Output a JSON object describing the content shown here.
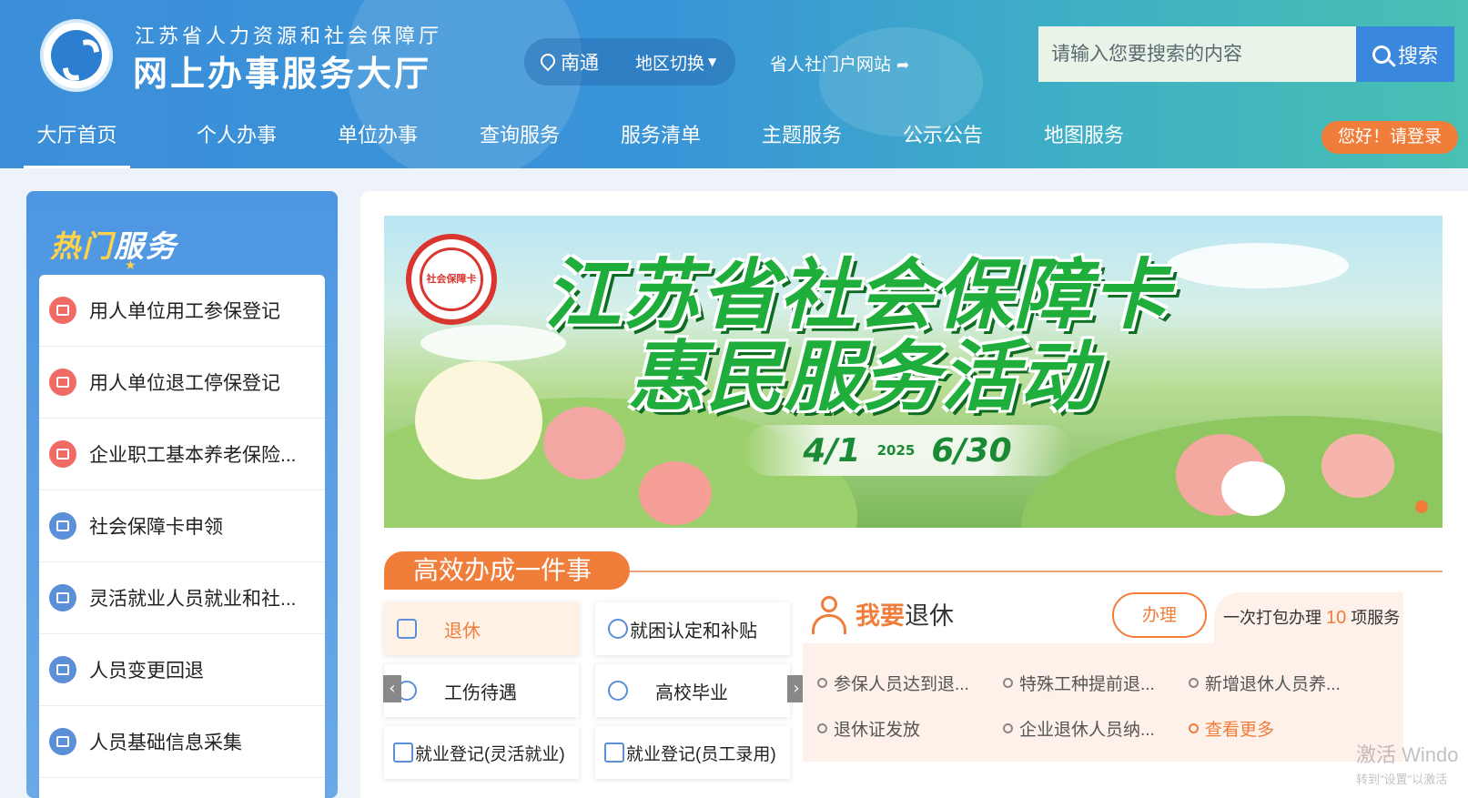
{
  "header": {
    "org_name": "江苏省人力资源和社会保障厅",
    "hall_name": "网上办事服务大厅",
    "region": {
      "city": "南通",
      "switch_label": "地区切换"
    },
    "portal_link": "省人社门户网站",
    "search": {
      "placeholder": "请输入您要搜索的内容",
      "button_label": "搜索"
    },
    "login_label": "您好！请登录"
  },
  "nav": {
    "items": [
      "大厅首页",
      "个人办事",
      "单位办事",
      "查询服务",
      "服务清单",
      "主题服务",
      "公示公告",
      "地图服务"
    ],
    "active": "大厅首页"
  },
  "hot_services": {
    "title_hot": "热门",
    "title_service": "服务",
    "items": [
      {
        "label": "用人单位用工参保登记",
        "icon": "insurance-register-icon"
      },
      {
        "label": "用人单位退工停保登记",
        "icon": "stop-insurance-icon"
      },
      {
        "label": "企业职工基本养老保险...",
        "icon": "pension-icon"
      },
      {
        "label": "社会保障卡申领",
        "icon": "card-apply-icon"
      },
      {
        "label": "灵活就业人员就业和社...",
        "icon": "flexible-employment-icon"
      },
      {
        "label": "人员变更回退",
        "icon": "change-rollback-icon"
      },
      {
        "label": "人员基础信息采集",
        "icon": "info-collect-icon"
      }
    ]
  },
  "banner": {
    "badge_text": "社会保障卡",
    "title_line1": "江苏省社会保障卡",
    "title_line2": "惠民服务活动",
    "date_start": "4/1",
    "year": "2025",
    "date_end": "6/30"
  },
  "one_thing": {
    "section_title": "高效办成一件事",
    "matters": [
      "退休",
      "就困认定和补贴",
      "工伤待遇",
      "高校毕业",
      "就业登记(灵活就业)",
      "就业登记(员工录用)"
    ],
    "selected": "退休",
    "retire": {
      "title_bold": "我要",
      "title_rest": "退休",
      "handle_label": "办理",
      "pack_prefix": "一次打包办理",
      "pack_count": "10",
      "pack_suffix": "项服务",
      "links": [
        "参保人员达到退...",
        "特殊工种提前退...",
        "新增退休人员养...",
        "退休证发放",
        "企业退休人员纳..."
      ],
      "more_label": "查看更多"
    }
  },
  "watermark": {
    "line1": "激活 Windo",
    "line2": "转到\"设置\"以激活"
  }
}
